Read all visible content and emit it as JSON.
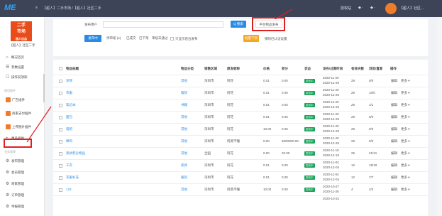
{
  "topbar": {
    "logo": "ME",
    "menu_icon": "≡",
    "breadcrumb": "【超人】二手市场 /【超人】社区二手",
    "right_items": [
      "授权站",
      "◆ ·",
      "◆ ·"
    ],
    "user": "【超人】社区..."
  },
  "sidebar": {
    "shop_logo_text": [
      "二手",
      "市场",
      "超人出品"
    ],
    "shop_name": "【超人】社区二手",
    "items": [
      {
        "icon": "⌂",
        "label": "概况首页"
      },
      {
        "icon": "☰",
        "label": "参数设置"
      },
      {
        "icon": "☐",
        "label": "操作前须知"
      }
    ],
    "group1": "使用插件",
    "plugins": [
      {
        "label": "广告插件"
      },
      {
        "label": "商家支付插件"
      },
      {
        "label": "上传图片插件"
      }
    ],
    "more": "更多插件",
    "group2": "业务管理",
    "manage": [
      {
        "icon": "⚙",
        "label": "发布管理"
      },
      {
        "icon": "⚙",
        "label": "会员管理"
      },
      {
        "icon": "⚙",
        "label": "商家管理"
      },
      {
        "icon": "⚙",
        "label": "订单管理"
      },
      {
        "icon": "⚙",
        "label": "举报管理"
      }
    ]
  },
  "filter": {
    "publisher_label": "发布用户",
    "publisher_placeholder": "",
    "search_label": "Q 搜索",
    "publish_button": "平台物品发布",
    "tabs": [
      "发布中",
      "待审核 (4)",
      "已成交",
      "已下架",
      "审核未通过"
    ],
    "only_platform": "只显示后台发布",
    "batch_down": "批量下架",
    "extra": "擦除已认证设置"
  },
  "table": {
    "headers": [
      "物品标题",
      "物品分类",
      "销售区域",
      "原发昵称",
      "价格",
      "积分",
      "状态",
      "发布/过期时间",
      "有效天数",
      "浏览/喜爱",
      "操作"
    ],
    "rows": [
      {
        "title": "深瑶",
        "cat": "其他",
        "area": "深圳市",
        "nick": "阿花",
        "price": "0.01",
        "points": "0.00",
        "status": "发布中",
        "time": [
          "2020-11-20",
          "2020-12-20"
        ],
        "days": "29",
        "views": "0/0"
      },
      {
        "title": "衣服",
        "cat": "服装",
        "area": "深圳市",
        "nick": "阿花",
        "price": "0.01",
        "points": "0.00",
        "status": "发布中",
        "time": [
          "2020-11-20",
          "2020-12-20"
        ],
        "days": "29",
        "views": "10/0"
      },
      {
        "title": "笔记本",
        "cat": "书籍",
        "area": "深圳市",
        "nick": "阿花",
        "price": "0.01",
        "points": "0.00",
        "status": "发布中",
        "time": [
          "2020-11-20",
          "2020-12-20"
        ],
        "days": "29",
        "views": "1/1"
      },
      {
        "title": "面包",
        "cat": "其他",
        "area": "深圳市",
        "nick": "阿花",
        "price": "0.01",
        "points": "0.00",
        "status": "发布中",
        "time": [
          "2020-11-20",
          "2020-12-20"
        ],
        "days": "29",
        "views": "0/0"
      },
      {
        "title": "电吧",
        "cat": "其他",
        "area": "深圳市",
        "nick": "阿花",
        "price": "10.00",
        "points": "0.00",
        "status": "发布中",
        "time": [
          "2020-11-20",
          "2020-12-20"
        ],
        "days": "29",
        "views": "0/0"
      },
      {
        "title": "棉鸡",
        "cat": "其他",
        "area": "深圳市",
        "nick": "阿莫不懂",
        "price": "0.00",
        "points": "5000000.00",
        "status": "发布中",
        "time": [
          "2020-11-20",
          "2020-12-20"
        ],
        "days": "29",
        "views": "0/0"
      },
      {
        "title": "测试积分物品",
        "cat": "其他",
        "area": "全国",
        "nick": "阿花",
        "price": "0.00",
        "points": "20.00",
        "status": "发布中",
        "time": [
          "2020-11-19",
          "2020-12-19"
        ],
        "days": "26",
        "views": "21/21"
      },
      {
        "title": "干衣",
        "cat": "家具",
        "area": "深圳市",
        "nick": "阿花",
        "price": "0.01",
        "points": "0.00",
        "status": "发布中",
        "time": [
          "2020-11-04",
          "2020-12-04"
        ],
        "days": "12",
        "views": "18/19"
      },
      {
        "title": "衣服补充",
        "cat": "服装",
        "area": "深圳市",
        "nick": "阿花",
        "price": "0.01",
        "points": "0.00",
        "status": "发布中",
        "time": [
          "2020-11-04",
          "2020-12-04"
        ],
        "days": "12",
        "views": "7/7"
      },
      {
        "title": "123",
        "cat": "其他",
        "area": "深圳市",
        "nick": "阿莫不懂",
        "price": "10.00",
        "points": "0.00",
        "status": "发布中",
        "time": [
          "2020-10-27",
          "2020-11-26"
        ],
        "days": "4",
        "views": "2/2"
      },
      {
        "title": "",
        "cat": "",
        "area": "",
        "nick": "",
        "price": "",
        "points": "",
        "status": "",
        "time": [
          "2020-10-22",
          ""
        ],
        "days": "",
        "views": ""
      }
    ],
    "op_edit": "编辑",
    "op_more": "更多 ▾"
  }
}
